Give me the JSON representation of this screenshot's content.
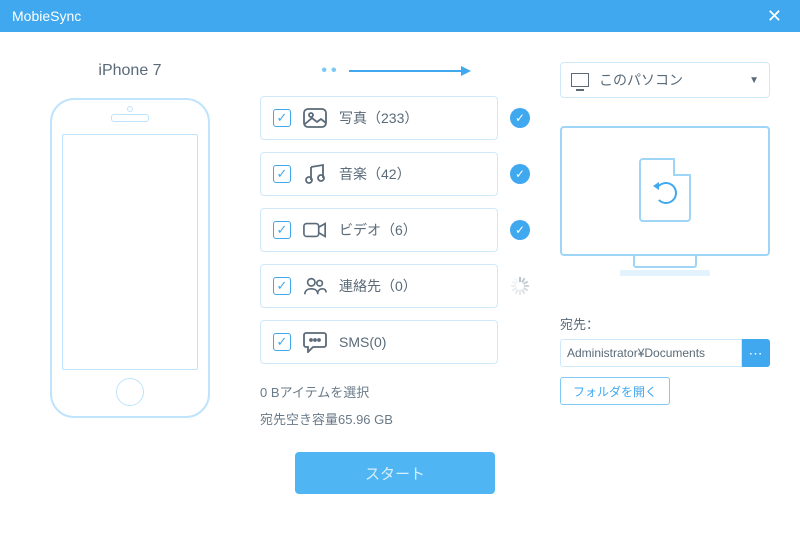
{
  "title": "MobieSync",
  "device": {
    "name": "iPhone 7"
  },
  "items": [
    {
      "key": "photos",
      "label": "写真（233）",
      "checked": true,
      "status": "done"
    },
    {
      "key": "music",
      "label": "音楽（42）",
      "checked": true,
      "status": "done"
    },
    {
      "key": "video",
      "label": "ビデオ（6）",
      "checked": true,
      "status": "done"
    },
    {
      "key": "contacts",
      "label": "連絡先（0）",
      "checked": true,
      "status": "loading"
    },
    {
      "key": "sms",
      "label": "SMS(0)",
      "checked": true,
      "status": "none"
    }
  ],
  "summary": {
    "selected": "0 Bアイテムを選択",
    "freespace": "宛先空き容量65.96 GB"
  },
  "start_label": "スタート",
  "destination": {
    "selector_label": "このパソコン",
    "field_label": "宛先：",
    "path": "Administrator¥Documents",
    "open_folder_label": "フォルダを開く"
  }
}
